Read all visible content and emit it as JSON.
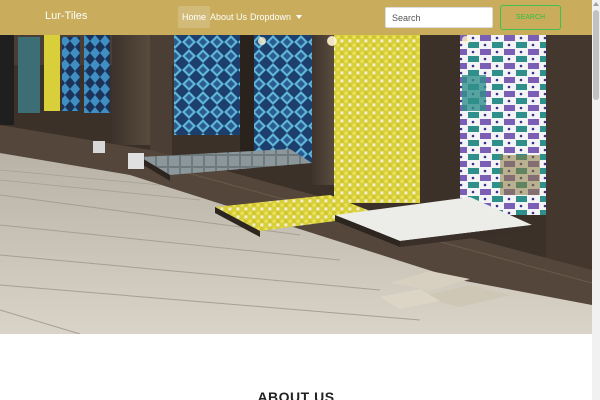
{
  "navbar": {
    "brand": "Lur-Tiles",
    "items": [
      {
        "label": "Home",
        "active": true
      },
      {
        "label": "About Us",
        "active": false
      },
      {
        "label": "Dropdown",
        "active": false
      }
    ],
    "search": {
      "placeholder": "Search",
      "button_label": "SEARCH"
    },
    "colors": {
      "background": "#c9ad5c",
      "search_button": "#3fbf4f"
    }
  },
  "carousel": {
    "slide_count": 3,
    "active_slide": 1
  },
  "about": {
    "heading": "ABOUT US"
  }
}
